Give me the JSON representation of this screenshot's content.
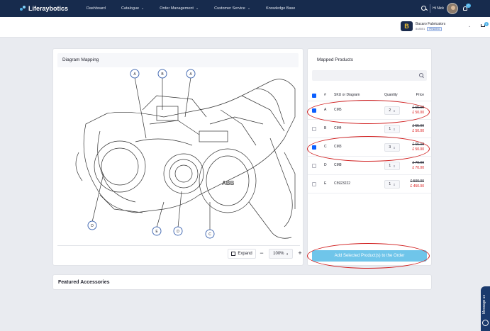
{
  "topnav": {
    "brand": "Liferaybotics",
    "links": [
      {
        "label": "Dashboard",
        "dropdown": false
      },
      {
        "label": "Catalogue",
        "dropdown": true
      },
      {
        "label": "Order Management",
        "dropdown": true
      },
      {
        "label": "Customer Service",
        "dropdown": true
      },
      {
        "label": "Knowledge Base",
        "dropdown": false
      }
    ],
    "greeting": "Hi Nick",
    "notifications": "0"
  },
  "account": {
    "name": "Bacaro Fabricators",
    "id": "848551",
    "status": "PENDING",
    "cart_count": "0"
  },
  "diagram": {
    "title": "Diagram Mapping",
    "pins": [
      "A",
      "B",
      "A",
      "D",
      "E",
      "D",
      "C"
    ],
    "expand_label": "Expand",
    "zoom_value": "100%",
    "minus_label": "−",
    "plus_label": "+"
  },
  "mapped": {
    "title": "Mapped Products",
    "search_placeholder": "",
    "headers": {
      "hash": "#",
      "sku": "SKU or Diagram",
      "qty": "Quantity",
      "price": "Price"
    },
    "rows": [
      {
        "pin": "A",
        "sku": "CM5",
        "qty": "2",
        "old": "£ 65.00",
        "new": "£ 50.00",
        "checked": true
      },
      {
        "pin": "B",
        "sku": "CM4",
        "qty": "1",
        "old": "£ 55.00",
        "new": "£ 50.00",
        "checked": false
      },
      {
        "pin": "C",
        "sku": "CM3",
        "qty": "3",
        "old": "£ 65.00",
        "new": "£ 50.00",
        "checked": true
      },
      {
        "pin": "D",
        "sku": "CM8",
        "qty": "1",
        "old": "£ 79.00",
        "new": "£ 70.00",
        "checked": false
      },
      {
        "pin": "E",
        "sku": "C5923222",
        "qty": "1",
        "old": "£ 500.00",
        "new": "£ 450.00",
        "checked": false
      }
    ],
    "add_button": "Add Selected Product(s) to the Order"
  },
  "featured": {
    "title": "Featured Accessories"
  },
  "message_tab": "Message us",
  "colors": {
    "nav_bg": "#172b4d",
    "accent": "#0b5fff",
    "button": "#6fc5ea",
    "sale_price": "#da1414",
    "annotation": "#d11f1f"
  }
}
